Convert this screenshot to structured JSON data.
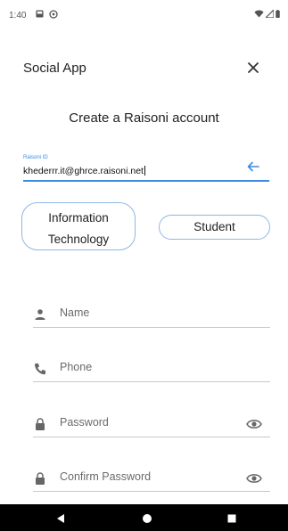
{
  "status_bar": {
    "time": "1:40"
  },
  "app_bar": {
    "title": "Social App"
  },
  "heading": "Create a Raisoni account",
  "id_field": {
    "label": "Raisoni ID",
    "value": "khederrr.it@ghrce.raisoni.net"
  },
  "chips": {
    "department": [
      "Information",
      "Technology"
    ],
    "role": "Student"
  },
  "fields": {
    "name": "Name",
    "phone": "Phone",
    "password": "Password",
    "confirm_password": "Confirm Password"
  },
  "colors": {
    "accent": "#3b8be0",
    "chip_border": "#8fb7e6",
    "divider": "#c9c9c9"
  }
}
